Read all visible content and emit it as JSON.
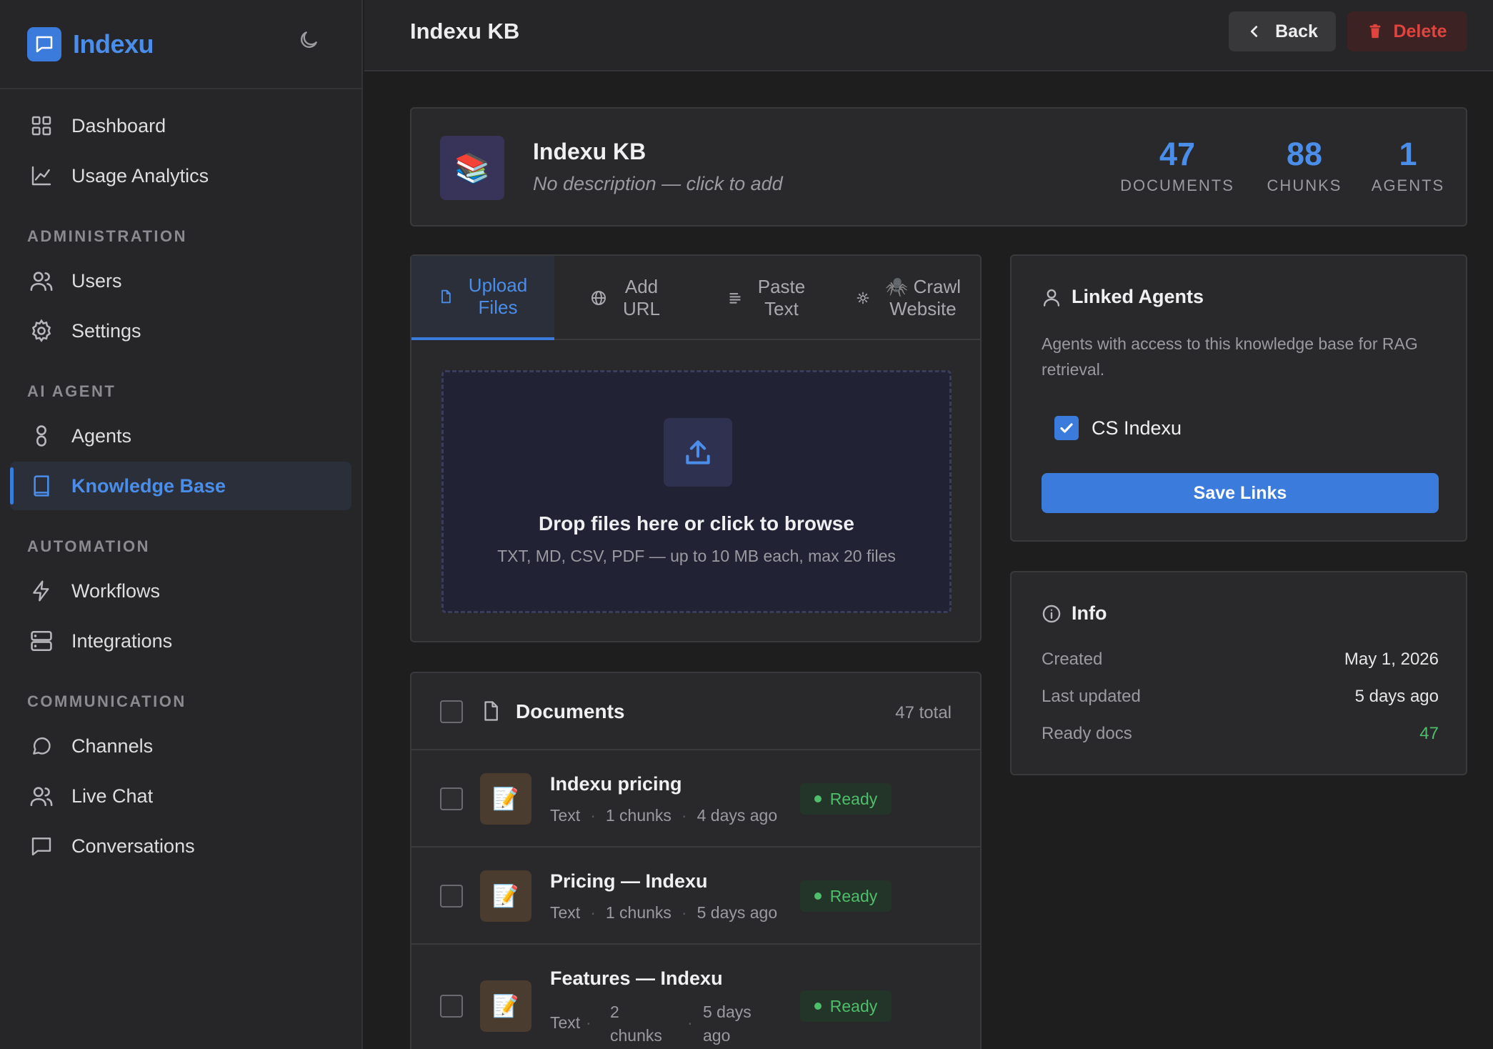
{
  "app": {
    "name": "Indexu"
  },
  "sidebar": {
    "items": [
      {
        "label": "Dashboard"
      },
      {
        "label": "Usage Analytics"
      },
      {
        "label": "Users"
      },
      {
        "label": "Settings"
      },
      {
        "label": "Agents"
      },
      {
        "label": "Knowledge Base"
      },
      {
        "label": "Workflows"
      },
      {
        "label": "Integrations"
      },
      {
        "label": "Channels"
      },
      {
        "label": "Live Chat"
      },
      {
        "label": "Conversations"
      }
    ],
    "sections": {
      "administration": "ADMINISTRATION",
      "ai_agent": "AI AGENT",
      "automation": "AUTOMATION",
      "communication": "COMMUNICATION"
    },
    "active_item": "Knowledge Base"
  },
  "topbar": {
    "title": "Indexu KB",
    "back_label": "Back",
    "delete_label": "Delete"
  },
  "kb": {
    "name": "Indexu KB",
    "description": "No description — click to add",
    "emoji": "📚",
    "stats": [
      {
        "value": "47",
        "label": "DOCUMENTS"
      },
      {
        "value": "88",
        "label": "CHUNKS"
      },
      {
        "value": "1",
        "label": "AGENTS"
      }
    ]
  },
  "tabs": [
    {
      "label": "Upload\nFiles",
      "icon": "file-icon",
      "active": true
    },
    {
      "label": "Add\nURL",
      "icon": "globe-icon",
      "active": false
    },
    {
      "label": "Paste\nText",
      "icon": "text-lines-icon",
      "active": false
    },
    {
      "label": "🕷️ Crawl\nWebsite",
      "icon": "sun-icon",
      "active": false
    }
  ],
  "dropzone": {
    "title": "Drop files here or click to browse",
    "subtitle": "TXT, MD, CSV, PDF — up to 10 MB each, max 20 files"
  },
  "documents": {
    "title": "Documents",
    "total": "47 total",
    "rows": [
      {
        "name": "Indexu pricing",
        "type": "Text",
        "chunks": "1 chunks",
        "age": "4 days ago",
        "status": "Ready",
        "emoji": "📝"
      },
      {
        "name": "Pricing — Indexu",
        "type": "Text",
        "chunks": "1 chunks",
        "age": "5 days ago",
        "status": "Ready",
        "emoji": "📝"
      },
      {
        "name": "Features — Indexu",
        "type": "Text",
        "chunks_line1": "2",
        "chunks_line2": "chunks",
        "age_line1": "5 days",
        "age_line2": "ago",
        "status": "Ready",
        "emoji": "📝"
      }
    ]
  },
  "linked_agents": {
    "title": "Linked Agents",
    "description": "Agents with access to this knowledge base for RAG retrieval.",
    "agents": [
      {
        "name": "CS Indexu",
        "checked": true
      }
    ],
    "save_label": "Save Links"
  },
  "info": {
    "title": "Info",
    "rows": [
      {
        "key": "Created",
        "value": "May 1, 2026"
      },
      {
        "key": "Last updated",
        "value": "5 days ago"
      },
      {
        "key": "Ready docs",
        "value": "47"
      }
    ]
  },
  "colors": {
    "accent": "#3a7bdc",
    "ready": "#4fbe6a",
    "danger": "#e0443e"
  }
}
